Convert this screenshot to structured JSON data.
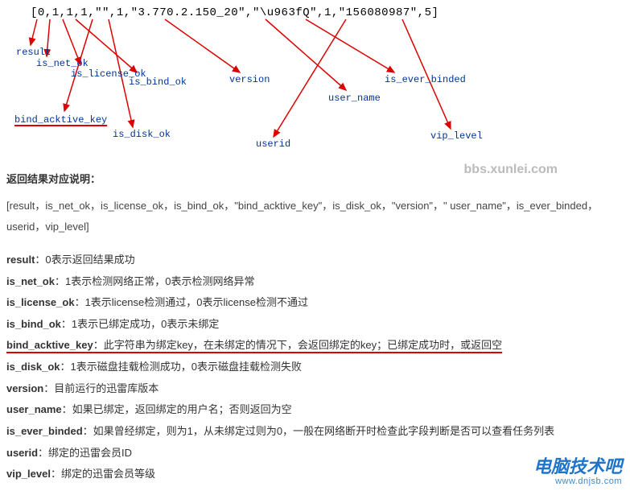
{
  "array_text": "[0,1,1,1,\"\",1,\"3.770.2.150_20\",\"\\u963fQ\",1,\"156080987\",5]",
  "labels": {
    "result": "result",
    "is_net_ok": "is_net_ok",
    "is_license_ok": "is_license_ok",
    "is_bind_ok": "is_bind_ok",
    "bind_acktive_key": "bind_acktive_key",
    "is_disk_ok": "is_disk_ok",
    "version": "version",
    "user_name": "user_name",
    "is_ever_binded": "is_ever_binded",
    "userid": "userid",
    "vip_level": "vip_level"
  },
  "watermark1": "bbs.xunlei.com",
  "section_title": "返回结果对应说明：",
  "field_list": "[result，is_net_ok，is_license_ok，is_bind_ok，\"bind_acktive_key\"，is_disk_ok，\"version\"，\" user_name\"，is_ever_binded，userid，vip_level]",
  "descriptions": [
    {
      "name": "result",
      "sep": "：",
      "text": "0表示返回结果成功",
      "hl": false
    },
    {
      "name": "is_net_ok",
      "sep": "：",
      "text": "1表示检测网络正常，0表示检测网络异常",
      "hl": false
    },
    {
      "name": "is_license_ok",
      "sep": "：",
      "text": "1表示license检测通过，0表示license检测不通过",
      "hl": false
    },
    {
      "name": "is_bind_ok",
      "sep": "：",
      "text": "1表示已绑定成功，0表示未绑定",
      "hl": false
    },
    {
      "name": "bind_acktive_key",
      "sep": "：",
      "text": "此字符串为绑定key，在未绑定的情况下，会返回绑定的key；已绑定成功时，或返回空",
      "hl": true
    },
    {
      "name": "is_disk_ok",
      "sep": "：",
      "text": "1表示磁盘挂载检测成功，0表示磁盘挂载检测失败",
      "hl": false
    },
    {
      "name": "version",
      "sep": "：",
      "text": "目前运行的迅雷库版本",
      "hl": false
    },
    {
      "name": "user_name",
      "sep": "：",
      "text": "如果已绑定，返回绑定的用户名；否则返回为空",
      "hl": false
    },
    {
      "name": "is_ever_binded",
      "sep": "：",
      "text": "如果曾经绑定，则为1，从未绑定过则为0，一般在网络断开时检查此字段判断是否可以查看任务列表",
      "hl": false
    },
    {
      "name": "userid",
      "sep": "：",
      "text": "绑定的迅雷会员ID",
      "hl": false
    },
    {
      "name": "vip_level",
      "sep": "：",
      "text": "绑定的迅雷会员等级",
      "hl": false
    }
  ],
  "watermark2": {
    "cn": "电脑技术吧",
    "url": "www.dnjsb.com"
  }
}
